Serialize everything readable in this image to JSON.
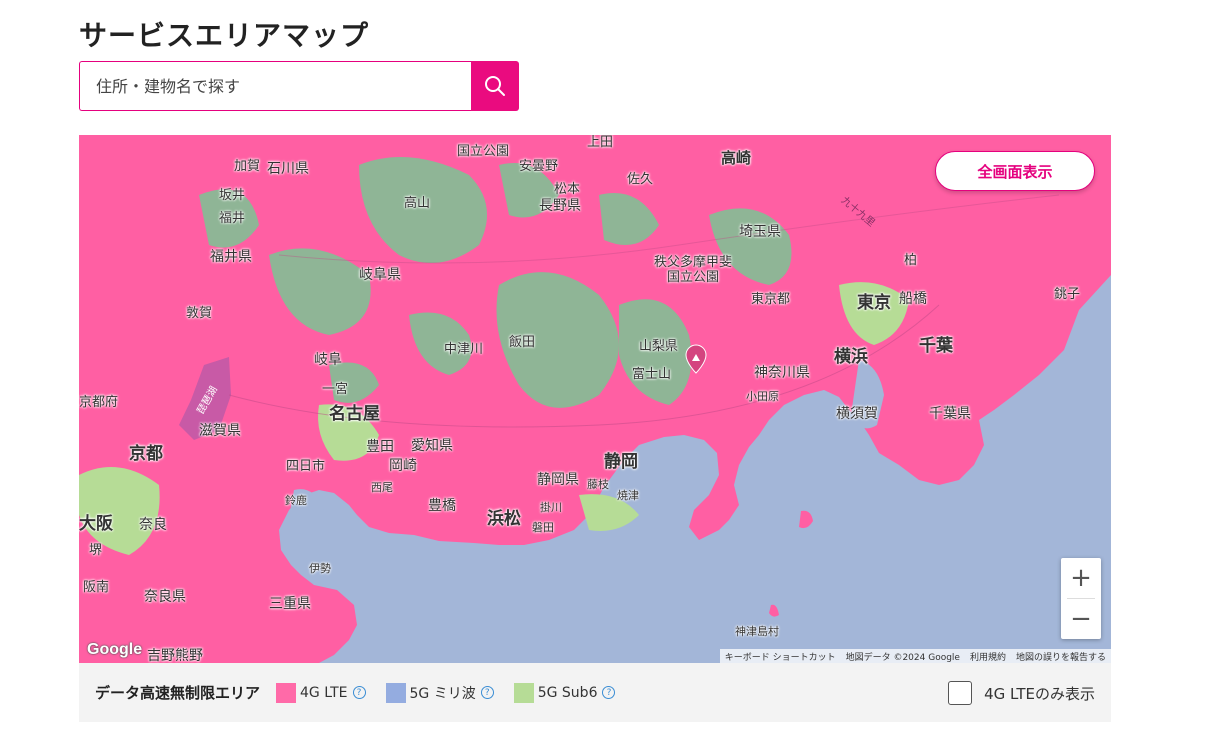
{
  "page": {
    "title": "サービスエリアマップ"
  },
  "search": {
    "placeholder": "住所・建物名で探す",
    "icon": "search-icon"
  },
  "map": {
    "fullscreen_label": "全画面表示",
    "zoom_in": "+",
    "zoom_out": "−",
    "google_logo": "Google",
    "attribution": [
      "キーボード ショートカット",
      "地図データ ©2024 Google",
      "利用規約",
      "地図の誤りを報告する"
    ],
    "places": [
      {
        "id": "kokuritsu-koen-n",
        "text": "国立公園"
      },
      {
        "id": "ueda",
        "text": "上田"
      },
      {
        "id": "takasaki",
        "text": "高崎"
      },
      {
        "id": "anzano",
        "text": "安曇野"
      },
      {
        "id": "kaga",
        "text": "加賀"
      },
      {
        "id": "ishikawa",
        "text": "石川県"
      },
      {
        "id": "matsumoto",
        "text": "松本"
      },
      {
        "id": "saku",
        "text": "佐久"
      },
      {
        "id": "sakai",
        "text": "坂井"
      },
      {
        "id": "nagano",
        "text": "長野県"
      },
      {
        "id": "fukui-city",
        "text": "福井"
      },
      {
        "id": "takayama",
        "text": "高山"
      },
      {
        "id": "saitama",
        "text": "埼玉県"
      },
      {
        "id": "fukui",
        "text": "福井県"
      },
      {
        "id": "chichibu",
        "text": "秩父多摩甲斐"
      },
      {
        "id": "kokuritsu-koen",
        "text": "国立公園"
      },
      {
        "id": "kashiwa",
        "text": "柏"
      },
      {
        "id": "gifu-pref",
        "text": "岐阜県"
      },
      {
        "id": "choshi",
        "text": "銚子"
      },
      {
        "id": "tokyo-to",
        "text": "東京都"
      },
      {
        "id": "tokyo",
        "text": "東京"
      },
      {
        "id": "funabashi",
        "text": "船橋"
      },
      {
        "id": "tsuruga",
        "text": "敦賀"
      },
      {
        "id": "iida",
        "text": "飯田"
      },
      {
        "id": "nakatsugawa",
        "text": "中津川"
      },
      {
        "id": "yamanashi",
        "text": "山梨県"
      },
      {
        "id": "chiba",
        "text": "千葉"
      },
      {
        "id": "gifu",
        "text": "岐阜"
      },
      {
        "id": "yokohama",
        "text": "横浜"
      },
      {
        "id": "fujisan",
        "text": "富士山"
      },
      {
        "id": "kanagawa",
        "text": "神奈川県"
      },
      {
        "id": "ichinomiya",
        "text": "一宮"
      },
      {
        "id": "odawara",
        "text": "小田原"
      },
      {
        "id": "kyotofu",
        "text": "京都府"
      },
      {
        "id": "nagoya",
        "text": "名古屋"
      },
      {
        "id": "yokosuka",
        "text": "横須賀"
      },
      {
        "id": "chiba-pref",
        "text": "千葉県"
      },
      {
        "id": "shiga",
        "text": "滋賀県"
      },
      {
        "id": "toyota",
        "text": "豊田"
      },
      {
        "id": "aichi",
        "text": "愛知県"
      },
      {
        "id": "kyoto",
        "text": "京都"
      },
      {
        "id": "shizuoka",
        "text": "静岡"
      },
      {
        "id": "yokkaichi",
        "text": "四日市"
      },
      {
        "id": "okazaki",
        "text": "岡崎"
      },
      {
        "id": "shizuoka-pref",
        "text": "静岡県"
      },
      {
        "id": "fujieda",
        "text": "藤枝"
      },
      {
        "id": "yaizu",
        "text": "焼津"
      },
      {
        "id": "nishio",
        "text": "西尾"
      },
      {
        "id": "toyohashi",
        "text": "豊橋"
      },
      {
        "id": "suzuka",
        "text": "鈴鹿"
      },
      {
        "id": "kakegawa",
        "text": "掛川"
      },
      {
        "id": "osaka",
        "text": "大阪"
      },
      {
        "id": "hamamatsu",
        "text": "浜松"
      },
      {
        "id": "nara",
        "text": "奈良"
      },
      {
        "id": "iwata",
        "text": "磐田"
      },
      {
        "id": "sakai-osaka",
        "text": "堺"
      },
      {
        "id": "ise",
        "text": "伊勢"
      },
      {
        "id": "hannan",
        "text": "阪南"
      },
      {
        "id": "nara-pref",
        "text": "奈良県"
      },
      {
        "id": "mie",
        "text": "三重県"
      },
      {
        "id": "kozushima",
        "text": "神津島村"
      },
      {
        "id": "yoshino",
        "text": "吉野熊野"
      },
      {
        "id": "biwako",
        "text": "琵琶湖"
      },
      {
        "id": "kujukuri",
        "text": "九十九里"
      }
    ]
  },
  "legend": {
    "title": "データ高速無制限エリア",
    "items": [
      {
        "label": "4G LTE",
        "color": "#ff6aa8",
        "help": "?"
      },
      {
        "label": "5G ミリ波",
        "color": "#94ace0",
        "help": "?"
      },
      {
        "label": "5G Sub6",
        "color": "#b6dc96",
        "help": "?"
      }
    ],
    "lte_only_label": "4G LTEのみ表示"
  }
}
